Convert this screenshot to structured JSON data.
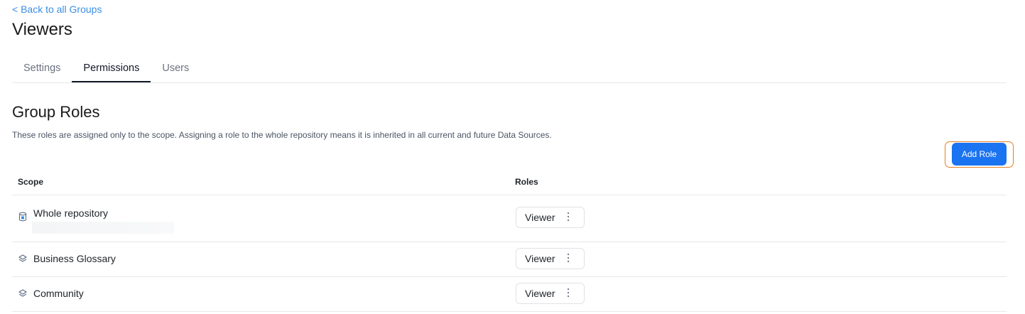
{
  "nav": {
    "back_label": "< Back to all Groups"
  },
  "page": {
    "title": "Viewers"
  },
  "tabs": [
    {
      "label": "Settings",
      "active": false
    },
    {
      "label": "Permissions",
      "active": true
    },
    {
      "label": "Users",
      "active": false
    }
  ],
  "section": {
    "title": "Group Roles",
    "description": "These roles are assigned only to the scope. Assigning a role to the whole repository means it is inherited in all current and future Data Sources.",
    "add_button_label": "Add Role"
  },
  "table": {
    "headers": {
      "scope": "Scope",
      "roles": "Roles"
    },
    "rows": [
      {
        "scope": "Whole repository",
        "scope_icon": "database-icon",
        "role": "Viewer"
      },
      {
        "scope": "Business Glossary",
        "scope_icon": "layers-icon",
        "role": "Viewer"
      },
      {
        "scope": "Community",
        "scope_icon": "layers-icon",
        "role": "Viewer"
      }
    ]
  },
  "colors": {
    "accent": "#1a73f0",
    "link": "#3b8ee6",
    "highlight": "#e67e22"
  }
}
